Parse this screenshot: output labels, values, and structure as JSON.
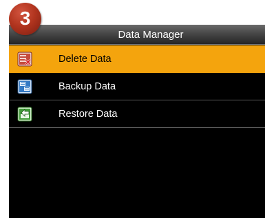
{
  "step": {
    "number": "3"
  },
  "title_bar": {
    "title": "Data Manager"
  },
  "menu": {
    "items": [
      {
        "label": "Delete Data",
        "icon": "delete-data-icon",
        "selected": true
      },
      {
        "label": "Backup Data",
        "icon": "backup-data-icon",
        "selected": false
      },
      {
        "label": "Restore Data",
        "icon": "restore-data-icon",
        "selected": false
      }
    ]
  },
  "colors": {
    "selected_row": "#f4a40d",
    "screen_background": "#000000",
    "badge": "#b2351f"
  }
}
